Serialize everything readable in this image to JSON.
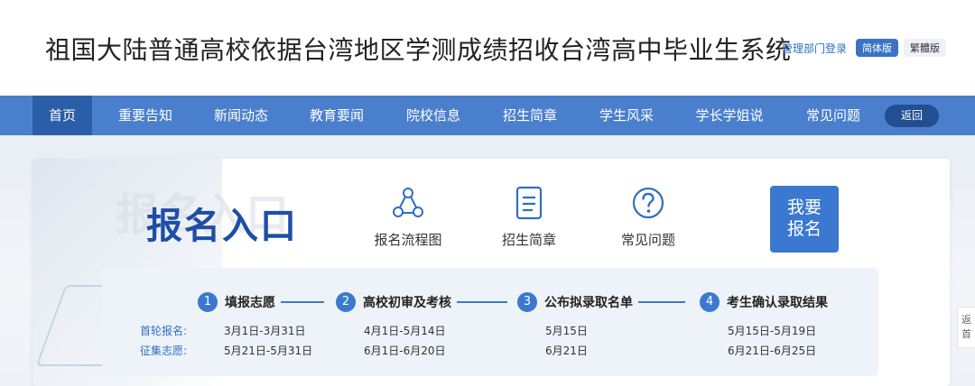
{
  "header": {
    "title": "祖国大陆普通高校依据台湾地区学测成绩招收台湾高中毕业生系统",
    "admin_login": "管理部门登录",
    "lang_simplified": "简体版",
    "lang_traditional": "繁體版"
  },
  "nav": {
    "items": [
      {
        "label": "首页"
      },
      {
        "label": "重要告知"
      },
      {
        "label": "新闻动态"
      },
      {
        "label": "教育要闻"
      },
      {
        "label": "院校信息"
      },
      {
        "label": "招生简章"
      },
      {
        "label": "学生风采"
      },
      {
        "label": "学长学姐说"
      },
      {
        "label": "常见问题"
      }
    ],
    "back_label": "返回"
  },
  "panel": {
    "heading": "报名入口",
    "watermark": "报名入口",
    "quick_links": [
      {
        "label": "报名流程图",
        "icon": "flowchart-icon"
      },
      {
        "label": "招生简章",
        "icon": "document-icon"
      },
      {
        "label": "常见问题",
        "icon": "question-icon"
      }
    ],
    "signup_line1": "我要",
    "signup_line2": "报名"
  },
  "timeline": {
    "steps": [
      {
        "num": "1",
        "label": "填报志愿"
      },
      {
        "num": "2",
        "label": "高校初审及考核"
      },
      {
        "num": "3",
        "label": "公布拟录取名单"
      },
      {
        "num": "4",
        "label": "考生确认录取结果"
      }
    ],
    "rows": [
      {
        "label": "首轮报名:",
        "dates": [
          "3月1日-3月31日",
          "4月1日-5月14日",
          "5月15日",
          "5月15日-5月19日"
        ]
      },
      {
        "label": "征集志愿:",
        "dates": [
          "5月21日-5月31日",
          "6月1日-6月20日",
          "6月21日",
          "6月21日-6月25日"
        ]
      }
    ]
  },
  "float_tab": {
    "line1": "返",
    "line2": "首"
  },
  "colors": {
    "nav_bg": "#4a7fcd",
    "nav_active": "#2b5ea8",
    "accent": "#3a79cf",
    "heading": "#1e4ea6"
  }
}
